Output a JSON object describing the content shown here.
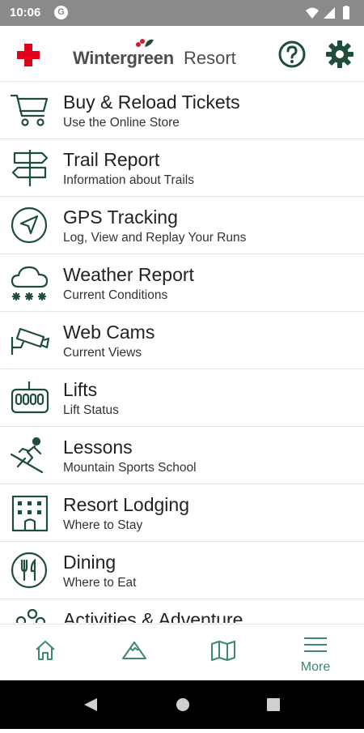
{
  "status": {
    "time": "10:06",
    "notification_icon": "g-icon",
    "system_icons": [
      "wifi-icon",
      "signal-icon",
      "battery-icon"
    ]
  },
  "header": {
    "logo_part1": "Wintergreen",
    "logo_part2": "Resort",
    "left_icon": "red-cross-icon",
    "right_icons": [
      "help-icon",
      "gear-icon"
    ],
    "brand_color": "#1e4d3a",
    "cross_color": "#e3001b"
  },
  "menu": [
    {
      "title": "Buy & Reload Tickets",
      "subtitle": "Use the Online Store",
      "icon": "cart-icon"
    },
    {
      "title": "Trail Report",
      "subtitle": "Information about Trails",
      "icon": "signpost-icon"
    },
    {
      "title": "GPS Tracking",
      "subtitle": "Log, View and Replay Your Runs",
      "icon": "navigation-icon"
    },
    {
      "title": "Weather Report",
      "subtitle": "Current Conditions",
      "icon": "snow-cloud-icon"
    },
    {
      "title": "Web Cams",
      "subtitle": "Current Views",
      "icon": "camera-icon"
    },
    {
      "title": "Lifts",
      "subtitle": "Lift Status",
      "icon": "gondola-icon"
    },
    {
      "title": "Lessons",
      "subtitle": "Mountain Sports School",
      "icon": "skier-icon"
    },
    {
      "title": "Resort Lodging",
      "subtitle": "Where to Stay",
      "icon": "building-icon"
    },
    {
      "title": "Dining",
      "subtitle": "Where to Eat",
      "icon": "dining-icon"
    },
    {
      "title": "Activities & Adventure",
      "subtitle": "",
      "icon": "activities-icon"
    }
  ],
  "bottom_nav": [
    {
      "icon": "home-icon",
      "label": ""
    },
    {
      "icon": "mountain-icon",
      "label": ""
    },
    {
      "icon": "map-icon",
      "label": ""
    },
    {
      "icon": "menu-icon",
      "label": "More"
    }
  ]
}
